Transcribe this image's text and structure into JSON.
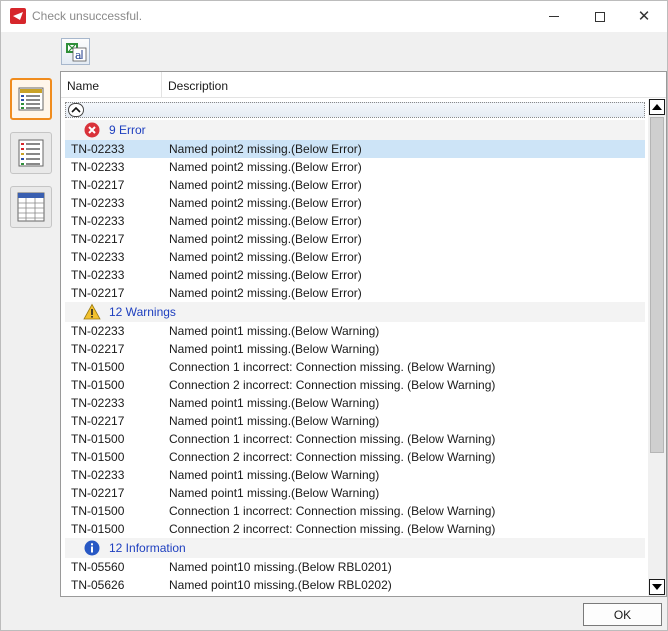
{
  "window": {
    "title": "Check unsuccessful.",
    "minimize": "minimize",
    "maximize": "maximize",
    "close": "✕"
  },
  "columns": {
    "name": "Name",
    "description": "Description"
  },
  "groups": [
    {
      "label": "9 Error",
      "icon": "error-icon",
      "rows": [
        {
          "name": "TN-02233",
          "desc": "Named point2 missing.(Below Error)"
        },
        {
          "name": "TN-02233",
          "desc": "Named point2 missing.(Below Error)"
        },
        {
          "name": "TN-02217",
          "desc": "Named point2 missing.(Below Error)"
        },
        {
          "name": "TN-02233",
          "desc": "Named point2 missing.(Below Error)"
        },
        {
          "name": "TN-02233",
          "desc": "Named point2 missing.(Below Error)"
        },
        {
          "name": "TN-02217",
          "desc": "Named point2 missing.(Below Error)"
        },
        {
          "name": "TN-02233",
          "desc": "Named point2 missing.(Below Error)"
        },
        {
          "name": "TN-02233",
          "desc": "Named point2 missing.(Below Error)"
        },
        {
          "name": "TN-02217",
          "desc": "Named point2 missing.(Below Error)"
        }
      ]
    },
    {
      "label": "12 Warnings",
      "icon": "warning-icon",
      "rows": [
        {
          "name": "TN-02233",
          "desc": "Named point1 missing.(Below Warning)"
        },
        {
          "name": "TN-02217",
          "desc": "Named point1 missing.(Below Warning)"
        },
        {
          "name": "TN-01500",
          "desc": "Connection 1 incorrect: Connection missing. (Below Warning)"
        },
        {
          "name": "TN-01500",
          "desc": "Connection 2 incorrect: Connection missing. (Below Warning)"
        },
        {
          "name": "TN-02233",
          "desc": "Named point1 missing.(Below Warning)"
        },
        {
          "name": "TN-02217",
          "desc": "Named point1 missing.(Below Warning)"
        },
        {
          "name": "TN-01500",
          "desc": "Connection 1 incorrect: Connection missing. (Below Warning)"
        },
        {
          "name": "TN-01500",
          "desc": "Connection 2 incorrect: Connection missing. (Below Warning)"
        },
        {
          "name": "TN-02233",
          "desc": "Named point1 missing.(Below Warning)"
        },
        {
          "name": "TN-02217",
          "desc": "Named point1 missing.(Below Warning)"
        },
        {
          "name": "TN-01500",
          "desc": "Connection 1 incorrect: Connection missing. (Below Warning)"
        },
        {
          "name": "TN-01500",
          "desc": "Connection 2 incorrect: Connection missing. (Below Warning)"
        }
      ]
    },
    {
      "label": "12 Information",
      "icon": "info-icon",
      "rows": [
        {
          "name": "TN-05560",
          "desc": "Named point10 missing.(Below RBL0201)"
        },
        {
          "name": "TN-05626",
          "desc": "Named point10 missing.(Below RBL0202)"
        }
      ]
    }
  ],
  "buttons": {
    "ok": "OK"
  },
  "colors": {
    "accent": "#f08c1e",
    "group_text": "#1e3fbf",
    "selected": "#cde4f7"
  }
}
